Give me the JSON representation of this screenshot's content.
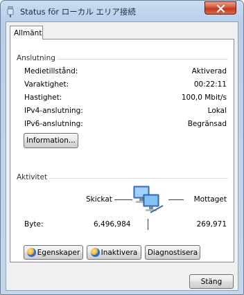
{
  "window": {
    "title": "Status för ローカル エリア接続",
    "close_glyph": "✕"
  },
  "tab": {
    "label": "Allmänt"
  },
  "connection": {
    "title": "Anslutning",
    "rows": [
      {
        "label": "Medietillstånd:",
        "value": "Aktiverad"
      },
      {
        "label": "Varaktighet:",
        "value": "00:22:11"
      },
      {
        "label": "Hastighet:",
        "value": "100,0 Mbit/s"
      },
      {
        "label": "IPv4-anslutning:",
        "value": "Lokal"
      },
      {
        "label": "IPv6-anslutning:",
        "value": "Begränsad"
      }
    ],
    "info_button": "Information..."
  },
  "activity": {
    "title": "Aktivitet",
    "sent_label": "Skickat",
    "received_label": "Mottaget",
    "bytes_label": "Byte:",
    "bytes_sent": "6,496,984",
    "bytes_received": "269,971",
    "icon": "network-computers-icon"
  },
  "buttons": {
    "properties": "Egenskaper",
    "disable": "Inaktivera",
    "diagnose": "Diagnostisera",
    "close": "Stäng"
  },
  "colors": {
    "frame": "#c3d6ed",
    "close_button": "#c23a1b",
    "panel": "#ffffff"
  }
}
